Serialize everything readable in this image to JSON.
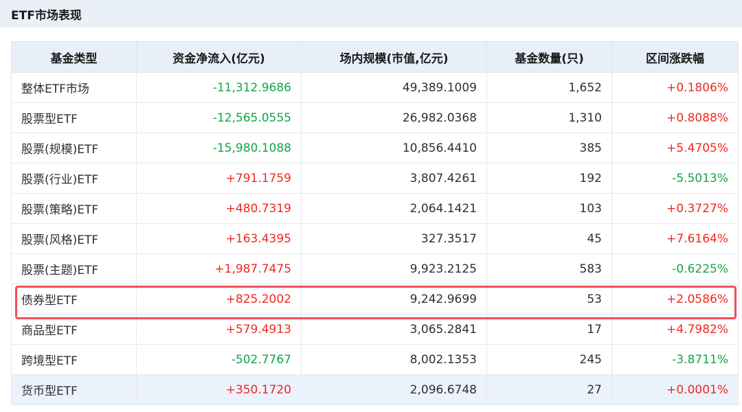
{
  "header": {
    "title": "ETF市场表现"
  },
  "table": {
    "columns": [
      "基金类型",
      "资金净流入(亿元)",
      "场内规模(市值,亿元)",
      "基金数量(只)",
      "区间涨跌幅"
    ],
    "rows": [
      {
        "type": "整体ETF市场",
        "inflow": "-11,312.9686",
        "inflow_sign": "neg",
        "scale": "49,389.1009",
        "count": "1,652",
        "change": "+0.1806%",
        "change_sign": "pos"
      },
      {
        "type": "股票型ETF",
        "inflow": "-12,565.0555",
        "inflow_sign": "neg",
        "scale": "26,982.0368",
        "count": "1,310",
        "change": "+0.8088%",
        "change_sign": "pos"
      },
      {
        "type": "股票(规模)ETF",
        "inflow": "-15,980.1088",
        "inflow_sign": "neg",
        "scale": "10,856.4410",
        "count": "385",
        "change": "+5.4705%",
        "change_sign": "pos"
      },
      {
        "type": "股票(行业)ETF",
        "inflow": "+791.1759",
        "inflow_sign": "pos",
        "scale": "3,807.4261",
        "count": "192",
        "change": "-5.5013%",
        "change_sign": "neg"
      },
      {
        "type": "股票(策略)ETF",
        "inflow": "+480.7319",
        "inflow_sign": "pos",
        "scale": "2,064.1421",
        "count": "103",
        "change": "+0.3727%",
        "change_sign": "pos"
      },
      {
        "type": "股票(风格)ETF",
        "inflow": "+163.4395",
        "inflow_sign": "pos",
        "scale": "327.3517",
        "count": "45",
        "change": "+7.6164%",
        "change_sign": "pos"
      },
      {
        "type": "股票(主题)ETF",
        "inflow": "+1,987.7475",
        "inflow_sign": "pos",
        "scale": "9,923.2125",
        "count": "583",
        "change": "-0.6225%",
        "change_sign": "neg"
      },
      {
        "type": "债券型ETF",
        "inflow": "+825.2002",
        "inflow_sign": "pos",
        "scale": "9,242.9699",
        "count": "53",
        "change": "+2.0586%",
        "change_sign": "pos"
      },
      {
        "type": "商品型ETF",
        "inflow": "+579.4913",
        "inflow_sign": "pos",
        "scale": "3,065.2841",
        "count": "17",
        "change": "+4.7982%",
        "change_sign": "pos"
      },
      {
        "type": "跨境型ETF",
        "inflow": "-502.7767",
        "inflow_sign": "neg",
        "scale": "8,002.1353",
        "count": "245",
        "change": "-3.8711%",
        "change_sign": "neg"
      },
      {
        "type": "货币型ETF",
        "inflow": "+350.1720",
        "inflow_sign": "pos",
        "scale": "2,096.6748",
        "count": "27",
        "change": "+0.0001%",
        "change_sign": "pos"
      }
    ],
    "highlighted_row": 7
  },
  "colors": {
    "header_bg": "#eaf0f8",
    "positive": "#f0281e",
    "negative": "#10a64a",
    "highlight_border": "#ef4f57"
  }
}
